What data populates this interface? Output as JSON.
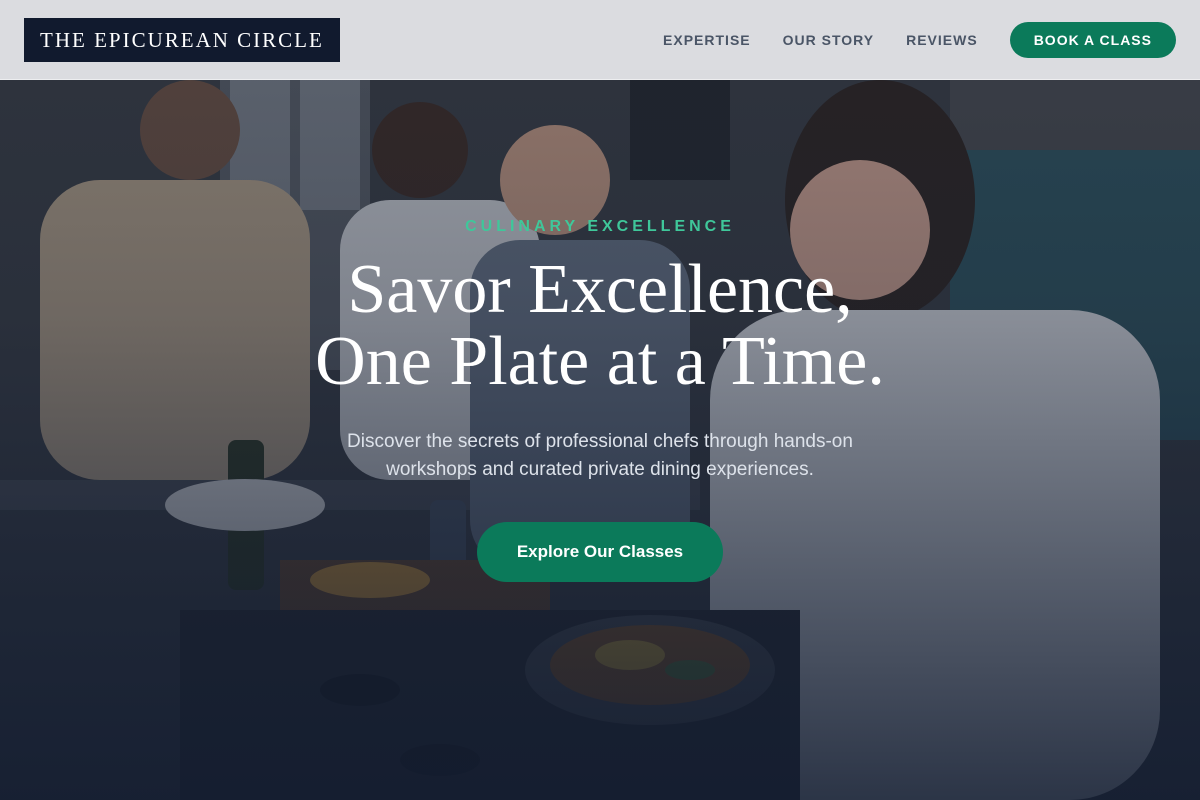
{
  "header": {
    "logo_text": "THE EPICUREAN CIRCLE",
    "nav": [
      {
        "label": "EXPERTISE"
      },
      {
        "label": "OUR STORY"
      },
      {
        "label": "REVIEWS"
      }
    ],
    "cta_label": "BOOK A CLASS"
  },
  "hero": {
    "eyebrow": "CULINARY EXCELLENCE",
    "headline_line1": "Savor Excellence,",
    "headline_line2": "One Plate at a Time.",
    "subtitle": "Discover the secrets of professional chefs through hands-on workshops and curated private dining experiences.",
    "button_label": "Explore Our Classes"
  },
  "colors": {
    "accent": "#0b7a5a",
    "eyebrow": "#3fc79a",
    "logo_bg": "#111a2e",
    "header_bg": "#e8eaed",
    "overlay": "#161e30"
  },
  "background_image": "photo of four people cooking together at a kitchen stove"
}
